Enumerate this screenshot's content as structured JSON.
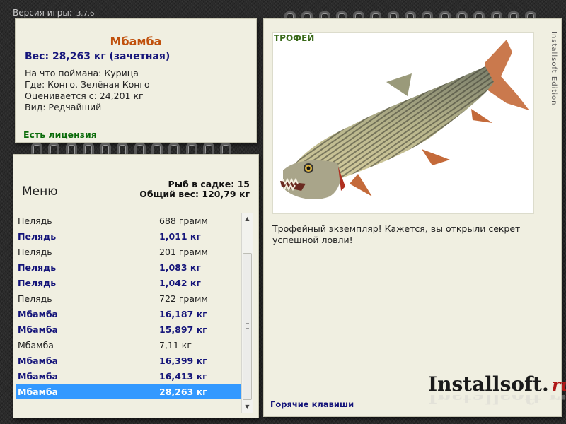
{
  "version": {
    "label": "Версия игры:",
    "number": "3.7.6"
  },
  "catch": {
    "fish_name": "Мбамба",
    "weight": "Вес: 28,263 кг (зачетная)",
    "caught_on": "На что поймана: Курица",
    "location": "Где: Конго, Зелёная Конго",
    "rated_from": "Оценивается с: 24,201 кг",
    "rarity": "Вид: Редчайший",
    "license": "Есть лицензия"
  },
  "menu": {
    "title": "Меню",
    "fish_count": "Рыб в садке: 15",
    "total_weight": "Общий вес: 120,79 кг",
    "rows": [
      {
        "name": "Пелядь",
        "weight": "688 грамм",
        "bold": false
      },
      {
        "name": "Пелядь",
        "weight": "1,011 кг",
        "bold": true
      },
      {
        "name": "Пелядь",
        "weight": "201 грамм",
        "bold": false
      },
      {
        "name": "Пелядь",
        "weight": "1,083 кг",
        "bold": true
      },
      {
        "name": "Пелядь",
        "weight": "1,042 кг",
        "bold": true
      },
      {
        "name": "Пелядь",
        "weight": "722 грамм",
        "bold": false
      },
      {
        "name": "Мбамба",
        "weight": "16,187 кг",
        "bold": true
      },
      {
        "name": "Мбамба",
        "weight": "15,897 кг",
        "bold": true
      },
      {
        "name": "Мбамба",
        "weight": "7,11 кг",
        "bold": false
      },
      {
        "name": "Мбамба",
        "weight": "16,399 кг",
        "bold": true
      },
      {
        "name": "Мбамба",
        "weight": "16,413 кг",
        "bold": true
      },
      {
        "name": "Мбамба",
        "weight": "28,263 кг",
        "bold": true,
        "selected": true
      }
    ]
  },
  "trophy": {
    "badge": "ТРОФЕЙ",
    "message": "Трофейный экземпляр! Кажется, вы открыли секрет успешной ловли!",
    "hotkeys": "Горячие клавиши"
  },
  "logo": {
    "main": "Installsoft.",
    "ru": "ru"
  },
  "side_text": "Installsoft Edition",
  "colors": {
    "selected_row": "#3399ff",
    "fish_name": "#c0500c",
    "bold_text": "#15157a",
    "license": "#0a6b0a"
  }
}
